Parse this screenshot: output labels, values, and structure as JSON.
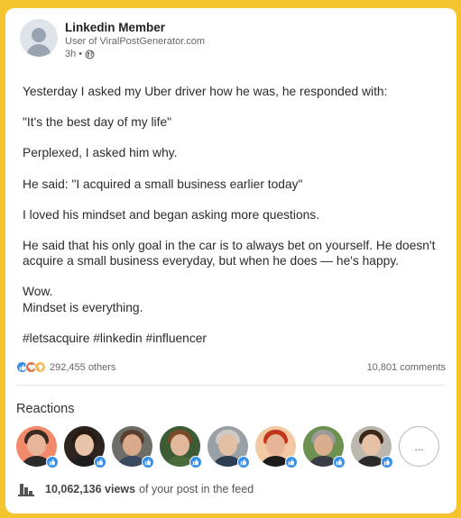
{
  "author": {
    "name": "Linkedin Member",
    "subtitle": "User of ViralPostGenerator.com",
    "time": "3h",
    "separator": "•",
    "visibility_icon": "globe-icon"
  },
  "post": {
    "paragraphs": [
      "Yesterday I asked my Uber driver how he was, he responded with:",
      "\"It's the best day of my life\"",
      "Perplexed, I asked him why.",
      "He said: \"I acquired a small business earlier today\"",
      "I loved his mindset and began asking more questions.",
      "He said that his only goal in the car is to always bet on yourself. He doesn't acquire a small business everyday, but when he does — he's happy.",
      "Wow.",
      "Mindset is everything."
    ],
    "hashtags": "#letsacquire #linkedin #influencer"
  },
  "stats": {
    "reaction_icons": [
      "like-icon",
      "love-icon",
      "insightful-icon"
    ],
    "reactions_count": "292,455 others",
    "comments": "10,801 comments"
  },
  "reactions_section": {
    "title": "Reactions",
    "more_label": "...",
    "reactors": [
      {
        "skin": "#e8b49a",
        "hair": "#3a2a22",
        "shirt": "#2b2b2b",
        "bg": "#f08a6a"
      },
      {
        "skin": "#e9c3a8",
        "hair": "#2a1a14",
        "shirt": "#1e1e1e",
        "bg": "#2d2420"
      },
      {
        "skin": "#d9ab8c",
        "hair": "#5a3f2e",
        "shirt": "#3b4a5e",
        "bg": "#6e6e68"
      },
      {
        "skin": "#e2b89a",
        "hair": "#7a4a2a",
        "shirt": "#4c6b3a",
        "bg": "#3d5b34"
      },
      {
        "skin": "#e3bfa4",
        "hair": "#cfcac4",
        "shirt": "#2f3e52",
        "bg": "#9aa1a6"
      },
      {
        "skin": "#e8b497",
        "hair": "#c2361c",
        "shirt": "#1c1c1c",
        "bg": "#f2c9a2"
      },
      {
        "skin": "#d8ae8e",
        "hair": "#9a9a98",
        "shirt": "#3a3d48",
        "bg": "#6c9150"
      },
      {
        "skin": "#e6c1a6",
        "hair": "#3b2618",
        "shirt": "#2a2a2a",
        "bg": "#bbb6ae"
      }
    ]
  },
  "views": {
    "icon": "bar-chart-icon",
    "count": "10,062,136 views",
    "suffix": "of your post in the feed"
  }
}
